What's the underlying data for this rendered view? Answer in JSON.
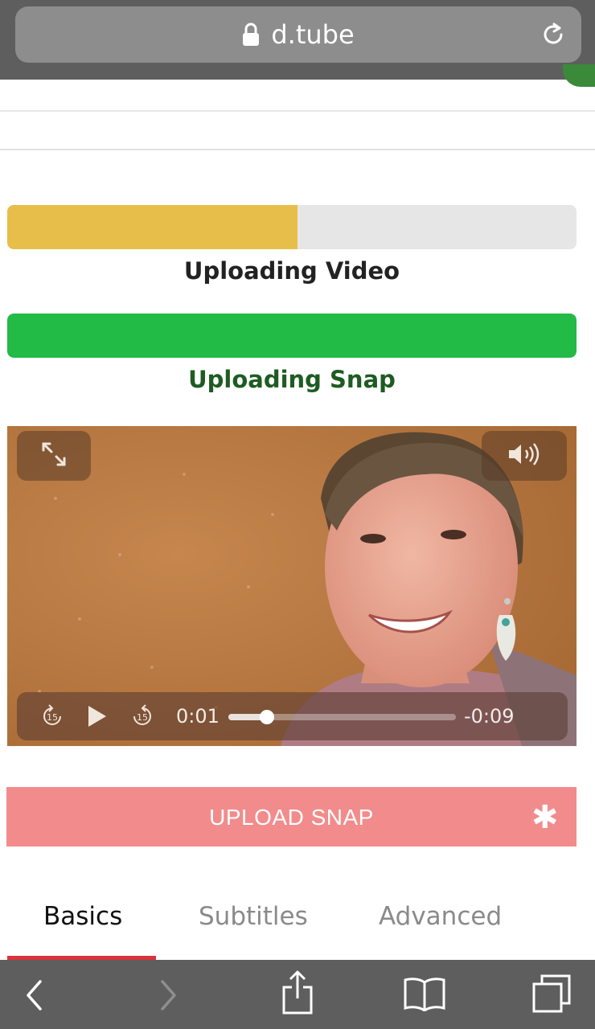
{
  "browser": {
    "url": "d.tube",
    "icons": {
      "lock": "lock-icon",
      "reload": "reload-icon"
    }
  },
  "upload": {
    "video": {
      "label": "Uploading Video",
      "progress": 0.51,
      "color": "#e8be4a",
      "label_color": "#222222"
    },
    "snap": {
      "label": "Uploading Snap",
      "progress": 1.0,
      "color": "#22bb45",
      "label_color": "#1e5c22"
    }
  },
  "player": {
    "current_time": "0:01",
    "remaining_time": "-0:09",
    "progress": 0.17,
    "icons": [
      "fullscreen-icon",
      "volume-icon",
      "rewind-15-icon",
      "play-icon",
      "forward-15-icon"
    ]
  },
  "actions": {
    "upload_snap_label": "UPLOAD SNAP",
    "upload_snap_color": "#f28c8c"
  },
  "tabs": [
    {
      "label": "Basics",
      "active": true
    },
    {
      "label": "Subtitles",
      "active": false
    },
    {
      "label": "Advanced",
      "active": false
    }
  ],
  "toolbar": {
    "icons": [
      "back-icon",
      "forward-icon",
      "share-icon",
      "bookmarks-icon",
      "tabs-icon"
    ]
  }
}
